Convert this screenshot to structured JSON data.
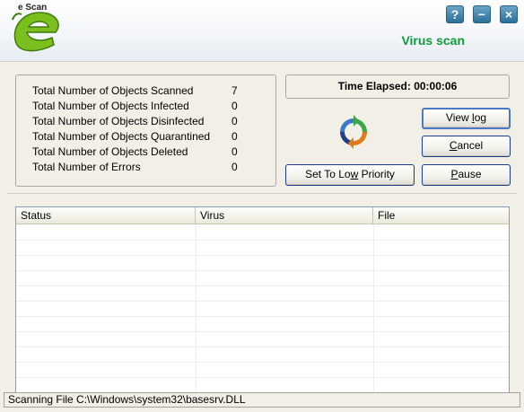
{
  "header": {
    "logo_text": "e Scan",
    "help_label": "?",
    "minimize_label": "−",
    "close_label": "×",
    "title": "Virus scan"
  },
  "stats": [
    {
      "label": "Total Number of Objects Scanned",
      "value": "7"
    },
    {
      "label": "Total Number of Objects Infected",
      "value": "0"
    },
    {
      "label": "Total Number of Objects Disinfected",
      "value": "0"
    },
    {
      "label": "Total Number of Objects Quarantined",
      "value": "0"
    },
    {
      "label": "Total Number of Objects Deleted",
      "value": "0"
    },
    {
      "label": "Total Number of Errors",
      "value": "0"
    }
  ],
  "time_elapsed": "Time Elapsed: 00:00:06",
  "buttons": {
    "view_log_pre": "View ",
    "view_log_key": "l",
    "view_log_post": "og",
    "cancel_key": "C",
    "cancel_post": "ancel",
    "low_priority_pre": "Set To Lo",
    "low_priority_key": "w",
    "low_priority_post": " Priority",
    "pause_key": "P",
    "pause_post": "ause"
  },
  "table": {
    "columns": [
      "Status",
      "Virus",
      "File"
    ],
    "rows": []
  },
  "status_bar": "Scanning File C:\\Windows\\system32\\basesrv.DLL",
  "colors": {
    "title_green": "#0e9a3a",
    "logo_green": "#7bbf1e",
    "button_blue": "#2c6f98",
    "panel_bg": "#f1efe6"
  },
  "icons": {
    "help": "help-icon",
    "minimize": "minimize-icon",
    "close": "close-icon",
    "refresh": "refresh-icon"
  }
}
